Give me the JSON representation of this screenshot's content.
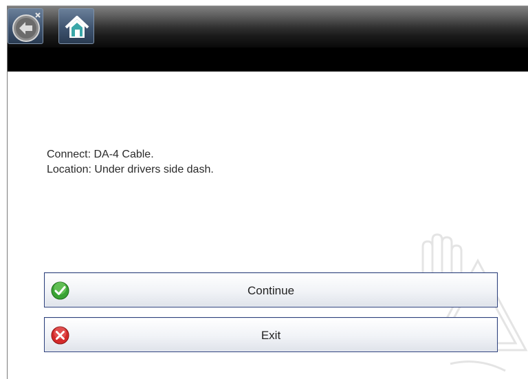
{
  "toolbar": {
    "back_icon": "back-arrow-icon",
    "home_icon": "home-icon"
  },
  "message": {
    "line1": "Connect: DA-4 Cable.",
    "line2": "Location: Under drivers side dash."
  },
  "buttons": {
    "continue_label": "Continue",
    "continue_icon": "checkmark-icon",
    "exit_label": "Exit",
    "exit_icon": "x-circle-icon"
  },
  "colors": {
    "toolbar_button": "#3f5470",
    "button_border": "#2c3f7a",
    "continue_icon": "#3aa335",
    "exit_icon": "#d42a2a"
  }
}
